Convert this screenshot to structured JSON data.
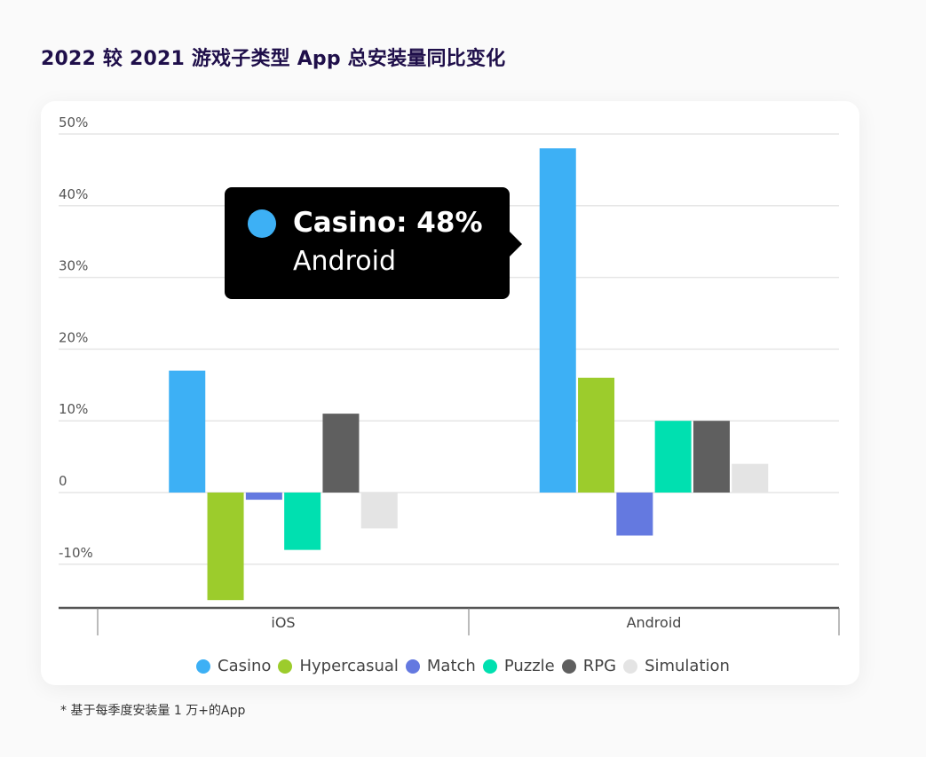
{
  "title": "2022 较 2021 游戏子类型 App 总安装量同比变化",
  "footnote": "* 基于每季度安装量 1 万+的App",
  "tooltip": {
    "series": "Casino",
    "title": "Casino: 48%",
    "category": "Android",
    "color": "#3db0f5"
  },
  "chart_data": {
    "type": "bar",
    "title": "2022 较 2021 游戏子类型 App 总安装量同比变化",
    "xlabel": "",
    "ylabel": "",
    "categories": [
      "iOS",
      "Android"
    ],
    "series": [
      {
        "name": "Casino",
        "color": "#3db0f5",
        "values": [
          17,
          48
        ]
      },
      {
        "name": "Hypercasual",
        "color": "#9ccc2c",
        "values": [
          -15,
          16
        ]
      },
      {
        "name": "Match",
        "color": "#6479e0",
        "values": [
          -1,
          -6
        ]
      },
      {
        "name": "Puzzle",
        "color": "#00e0b0",
        "values": [
          -8,
          10
        ]
      },
      {
        "name": "RPG",
        "color": "#5f5f5f",
        "values": [
          11,
          10
        ]
      },
      {
        "name": "Simulation",
        "color": "#e4e4e4",
        "values": [
          -5,
          4
        ]
      }
    ],
    "yticks": [
      50,
      40,
      30,
      20,
      10,
      0,
      -10
    ],
    "ytick_labels": [
      "50%",
      "40%",
      "30%",
      "20%",
      "10%",
      "0",
      "-10%"
    ],
    "ylim": [
      -16,
      50
    ],
    "grid": true,
    "legend": "bottom-center"
  }
}
